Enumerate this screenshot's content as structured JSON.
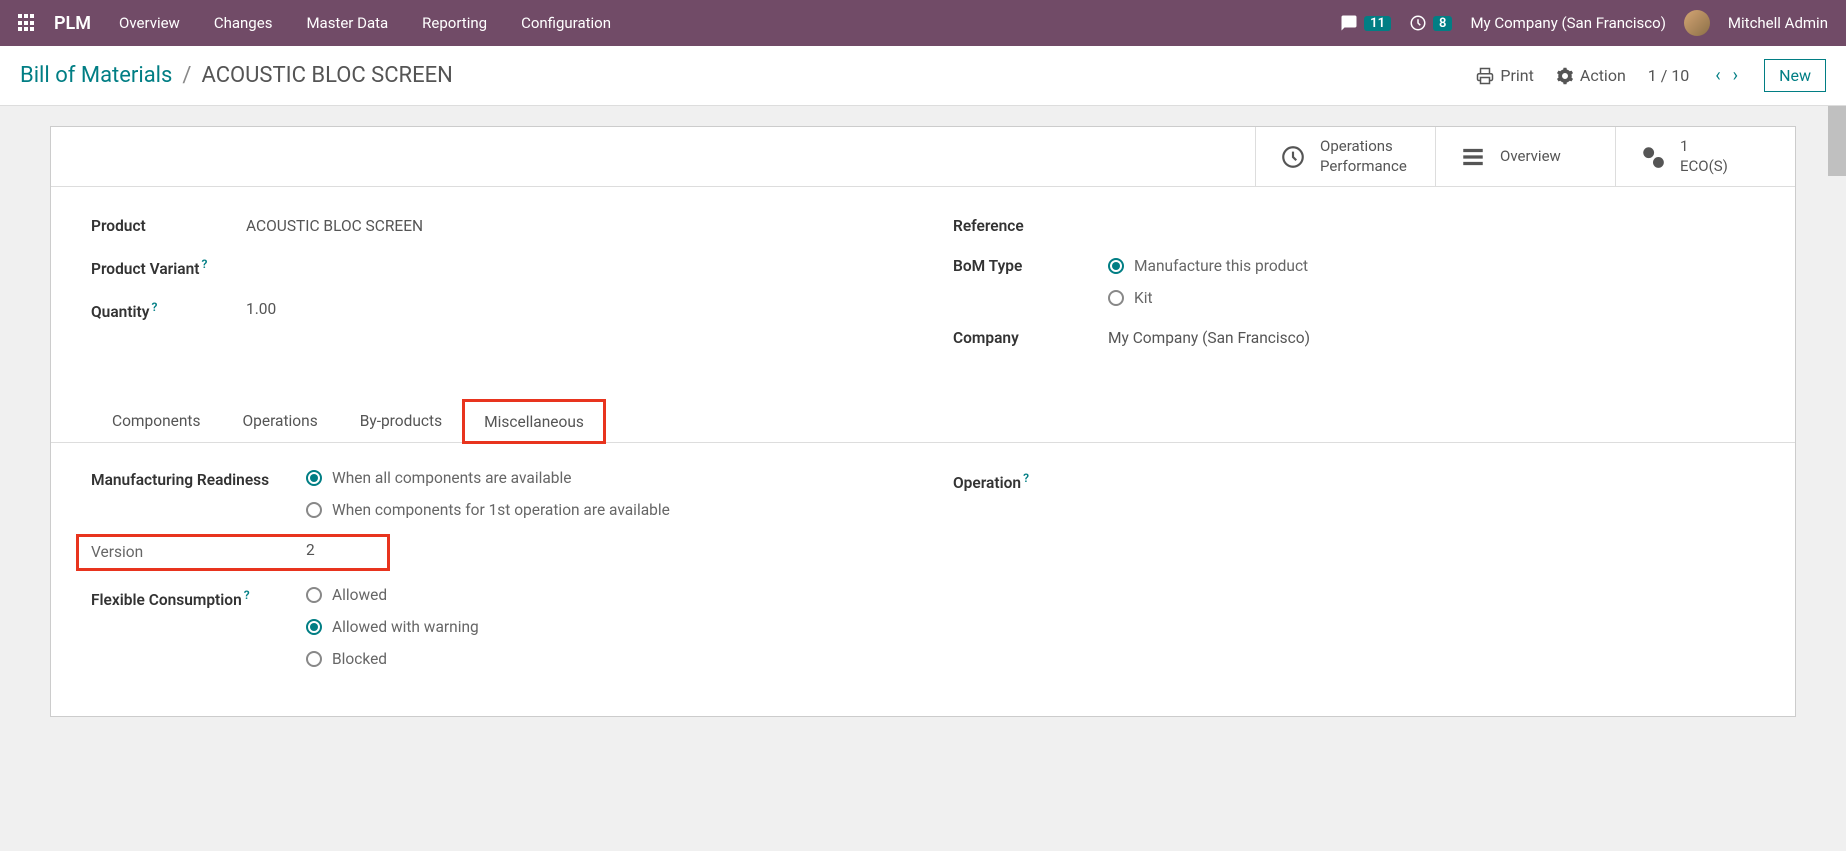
{
  "topbar": {
    "brand": "PLM",
    "nav": [
      "Overview",
      "Changes",
      "Master Data",
      "Reporting",
      "Configuration"
    ],
    "messages_badge": "11",
    "activities_badge": "8",
    "company": "My Company (San Francisco)",
    "user": "Mitchell Admin"
  },
  "subheader": {
    "breadcrumb_root": "Bill of Materials",
    "breadcrumb_sep": "/",
    "breadcrumb_current": "ACOUSTIC BLOC SCREEN",
    "print": "Print",
    "action": "Action",
    "pager": "1 / 10",
    "new": "New"
  },
  "stats": {
    "op1_line1": "Operations",
    "op1_line2": "Performance",
    "op2": "Overview",
    "op3_count": "1",
    "op3_label": "ECO(S)"
  },
  "form": {
    "product_label": "Product",
    "product_value": "ACOUSTIC BLOC SCREEN",
    "variant_label": "Product Variant",
    "quantity_label": "Quantity",
    "quantity_value": "1.00",
    "reference_label": "Reference",
    "bom_type_label": "BoM Type",
    "bom_type_opt1": "Manufacture this product",
    "bom_type_opt2": "Kit",
    "company_label": "Company",
    "company_value": "My Company (San Francisco)"
  },
  "tabs": [
    "Components",
    "Operations",
    "By-products",
    "Miscellaneous"
  ],
  "misc": {
    "mfg_ready_label": "Manufacturing Readiness",
    "mfg_ready_opt1": "When all components are available",
    "mfg_ready_opt2": "When components for 1st operation are available",
    "version_label": "Version",
    "version_value": "2",
    "flex_label": "Flexible Consumption",
    "flex_opt1": "Allowed",
    "flex_opt2": "Allowed with warning",
    "flex_opt3": "Blocked",
    "operation_label": "Operation"
  },
  "help": "?"
}
